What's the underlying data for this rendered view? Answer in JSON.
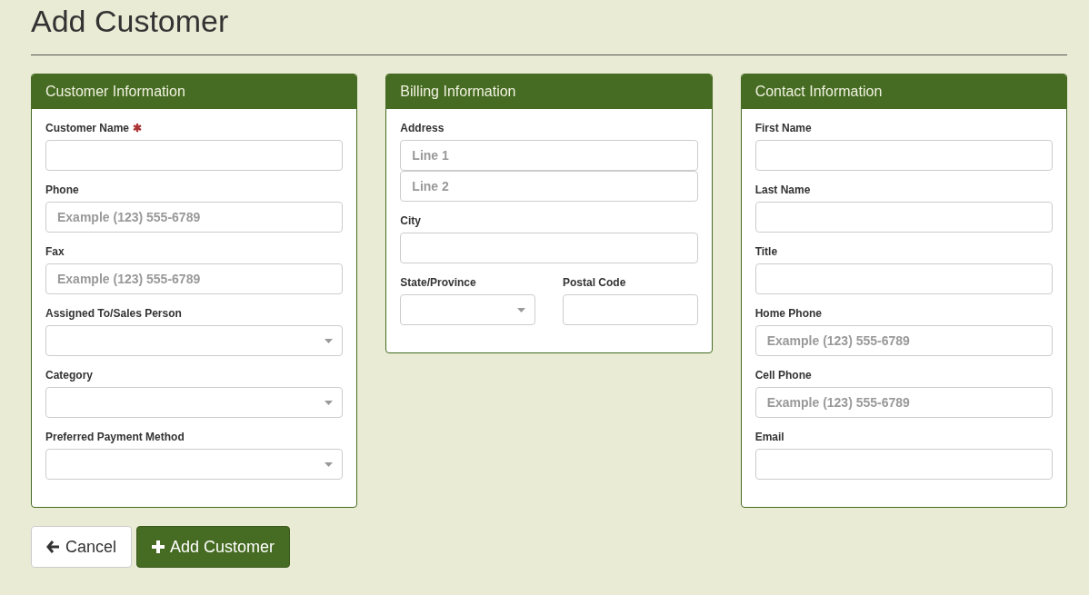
{
  "page_title": "Add Customer",
  "required_mark": "✱",
  "panels": [
    {
      "title": "Customer Information",
      "fields": [
        {
          "kind": "text",
          "label": "Customer Name",
          "required": true
        },
        {
          "kind": "text",
          "label": "Phone",
          "required": false,
          "placeholder": "Example (123) 555-6789"
        },
        {
          "kind": "text",
          "label": "Fax",
          "required": false,
          "placeholder": "Example (123) 555-6789"
        },
        {
          "kind": "select",
          "label": "Assigned To/Sales Person",
          "required": false
        },
        {
          "kind": "select",
          "label": "Category",
          "required": false
        },
        {
          "kind": "select",
          "label": "Preferred Payment Method",
          "required": false
        }
      ]
    },
    {
      "title": "Billing Information",
      "fields": [
        {
          "kind": "address",
          "label": "Address",
          "required": false,
          "placeholders": [
            "Line 1",
            "Line 2"
          ]
        },
        {
          "kind": "text",
          "label": "City",
          "required": false
        },
        {
          "kind": "row",
          "fields": [
            {
              "kind": "select",
              "label": "State/Province",
              "required": false
            },
            {
              "kind": "text",
              "label": "Postal Code",
              "required": false
            }
          ]
        }
      ]
    },
    {
      "title": "Contact Information",
      "fields": [
        {
          "kind": "text",
          "label": "First Name",
          "required": false
        },
        {
          "kind": "text",
          "label": "Last Name",
          "required": false
        },
        {
          "kind": "text",
          "label": "Title",
          "required": false
        },
        {
          "kind": "text",
          "label": "Home Phone",
          "required": false,
          "placeholder": "Example (123) 555-6789"
        },
        {
          "kind": "text",
          "label": "Cell Phone",
          "required": false,
          "placeholder": "Example (123) 555-6789"
        },
        {
          "kind": "text",
          "label": "Email",
          "required": false
        }
      ]
    }
  ],
  "buttons": [
    {
      "kind": "cancel",
      "label": "Cancel"
    },
    {
      "kind": "submit",
      "label": "Add Customer"
    }
  ]
}
